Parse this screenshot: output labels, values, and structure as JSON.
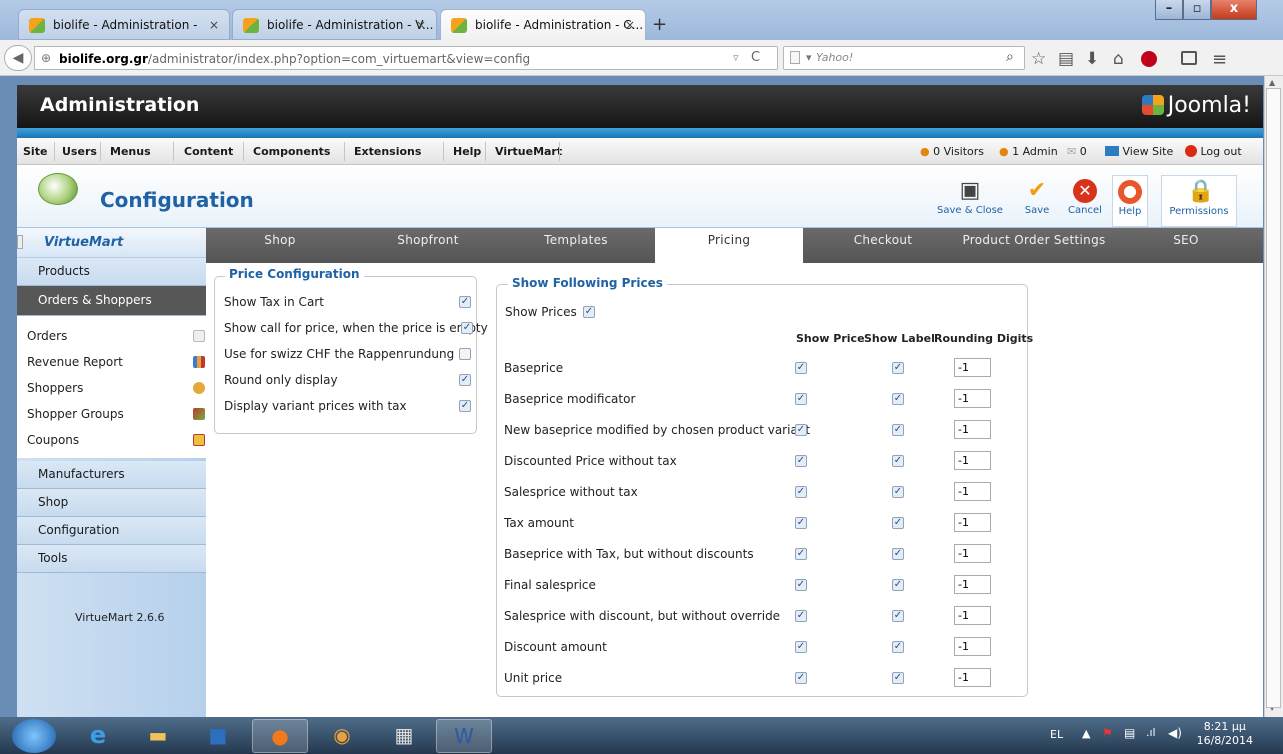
{
  "browser": {
    "tabs": [
      {
        "title": "biolife - Administration -"
      },
      {
        "title": "biolife - Administration - V..."
      },
      {
        "title": "biolife - Administration - C..."
      }
    ],
    "new_tab": "+",
    "close_glyph": "×",
    "url_domain": "biolife.org.gr",
    "url_path": "/administrator/index.php?option=com_virtuemart&view=config",
    "search_placeholder": "Yahoo!",
    "search_prefix": "▾"
  },
  "admin": {
    "title": "Administration",
    "brand": "Joomla!"
  },
  "menu": {
    "items": [
      "Site",
      "Users",
      "Menus",
      "Content",
      "Components",
      "Extensions",
      "Help",
      "VirtueMart"
    ],
    "visitors": "0 Visitors",
    "admins": "1 Admin",
    "messages": "0",
    "view_site": "View Site",
    "logout": "Log out"
  },
  "toolbar": {
    "title": "Configuration",
    "buttons": {
      "save_close": "Save & Close",
      "save": "Save",
      "cancel": "Cancel",
      "help": "Help",
      "permissions": "Permissions"
    }
  },
  "sidebar": {
    "logo": "VirtueMart",
    "products": "Products",
    "orders_shoppers": "Orders & Shoppers",
    "items": [
      "Orders",
      "Revenue Report",
      "Shoppers",
      "Shopper Groups",
      "Coupons"
    ],
    "manufacturers": "Manufacturers",
    "shop": "Shop",
    "configuration": "Configuration",
    "tools": "Tools",
    "version": "VirtueMart 2.6.6"
  },
  "tabs": [
    "Shop",
    "Shopfront",
    "Templates",
    "Pricing",
    "Checkout",
    "Product Order Settings",
    "SEO"
  ],
  "price_config": {
    "legend": "Price Configuration",
    "rows": [
      {
        "label": "Show Tax in Cart",
        "checked": true
      },
      {
        "label": "Show call for price, when the price is empty",
        "checked": true
      },
      {
        "label": "Use for swizz CHF the Rappenrundung",
        "checked": false
      },
      {
        "label": "Round only display",
        "checked": true
      },
      {
        "label": "Display variant prices with tax",
        "checked": true
      }
    ]
  },
  "show_prices": {
    "legend": "Show Following Prices",
    "show_prices_label": "Show Prices",
    "col_show_price": "Show Price",
    "col_show_label": "Show Label",
    "col_rounding": "Rounding Digits",
    "rows": [
      {
        "label": "Baseprice",
        "rounding": "-1"
      },
      {
        "label": "Baseprice modificator",
        "rounding": "-1"
      },
      {
        "label": "New baseprice modified by chosen product variant",
        "rounding": "-1"
      },
      {
        "label": "Discounted Price without tax",
        "rounding": "-1"
      },
      {
        "label": "Salesprice without tax",
        "rounding": "-1"
      },
      {
        "label": "Tax amount",
        "rounding": "-1"
      },
      {
        "label": "Baseprice with Tax, but without discounts",
        "rounding": "-1"
      },
      {
        "label": "Final salesprice",
        "rounding": "-1"
      },
      {
        "label": "Salesprice with discount, but without override",
        "rounding": "-1"
      },
      {
        "label": "Discount amount",
        "rounding": "-1"
      },
      {
        "label": "Unit price",
        "rounding": "-1"
      }
    ]
  },
  "taskbar": {
    "lang": "EL",
    "time": "8:21 μμ",
    "date": "16/8/2014"
  },
  "check_glyph": "✓"
}
